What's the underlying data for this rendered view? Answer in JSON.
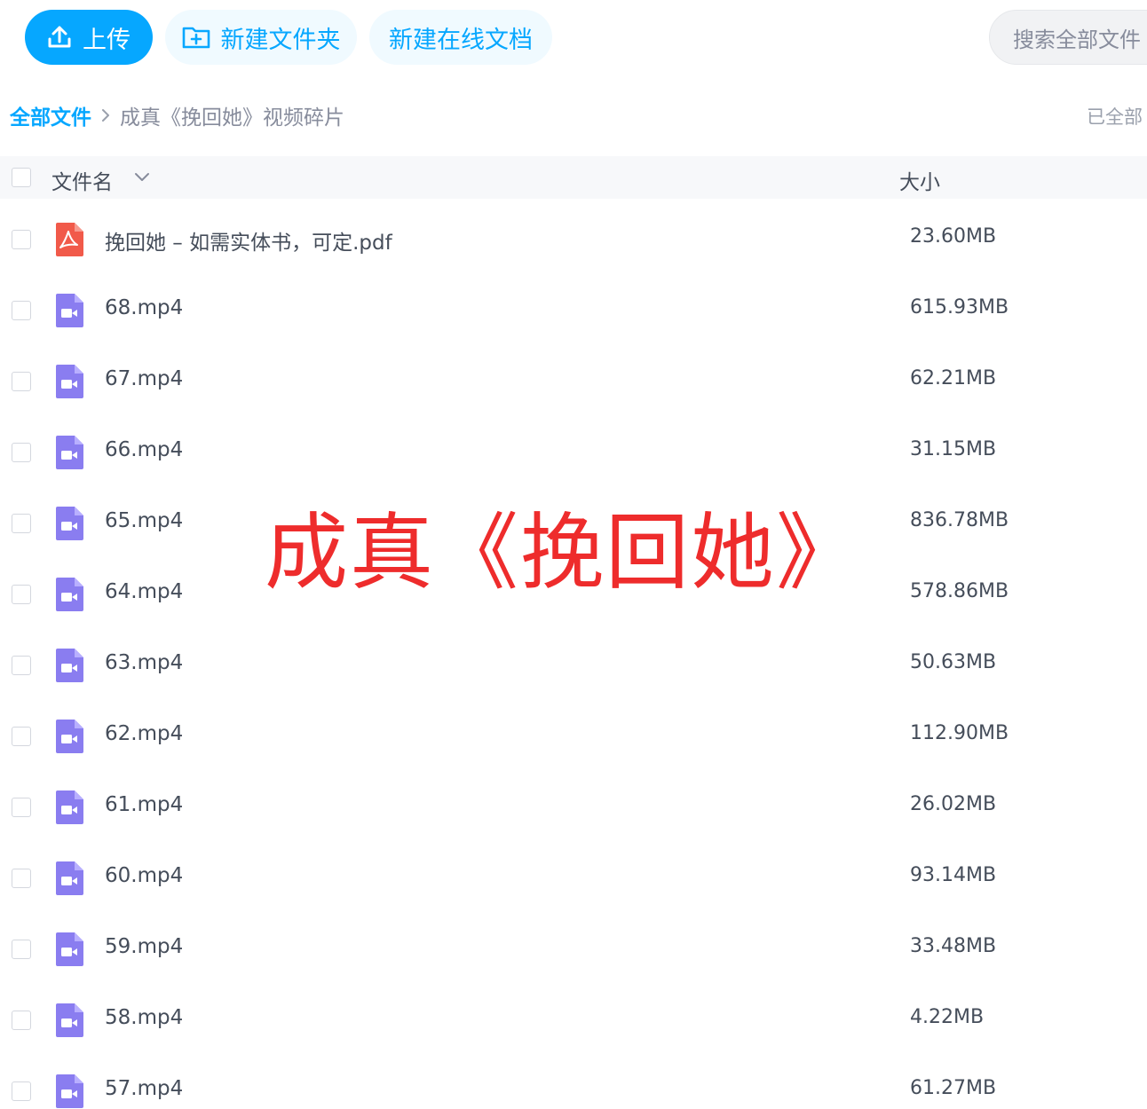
{
  "toolbar": {
    "upload_label": "上传",
    "new_folder_label": "新建文件夹",
    "new_online_doc_label": "新建在线文档",
    "search_placeholder": "搜索全部文件"
  },
  "breadcrumb": {
    "root": "全部文件",
    "current": "成真《挽回她》视频碎片",
    "loaded_status": "已全部"
  },
  "list_header": {
    "name": "文件名",
    "size": "大小"
  },
  "files": [
    {
      "name": "挽回她 – 如需实体书，可定.pdf",
      "size": "23.60MB",
      "type": "pdf"
    },
    {
      "name": "68.mp4",
      "size": "615.93MB",
      "type": "video"
    },
    {
      "name": "67.mp4",
      "size": "62.21MB",
      "type": "video"
    },
    {
      "name": "66.mp4",
      "size": "31.15MB",
      "type": "video"
    },
    {
      "name": "65.mp4",
      "size": "836.78MB",
      "type": "video"
    },
    {
      "name": "64.mp4",
      "size": "578.86MB",
      "type": "video"
    },
    {
      "name": "63.mp4",
      "size": "50.63MB",
      "type": "video"
    },
    {
      "name": "62.mp4",
      "size": "112.90MB",
      "type": "video"
    },
    {
      "name": "61.mp4",
      "size": "26.02MB",
      "type": "video"
    },
    {
      "name": "60.mp4",
      "size": "93.14MB",
      "type": "video"
    },
    {
      "name": "59.mp4",
      "size": "33.48MB",
      "type": "video"
    },
    {
      "name": "58.mp4",
      "size": "4.22MB",
      "type": "video"
    },
    {
      "name": "57.mp4",
      "size": "61.27MB",
      "type": "video"
    }
  ],
  "overlay": {
    "title": "成真《挽回她》"
  },
  "colors": {
    "accent": "#06a7ff",
    "pdf_icon": "#f15a4a",
    "video_icon": "#8a7df0",
    "overlay_text": "#ee2c2c"
  },
  "icons": {
    "upload": "upload-icon",
    "new_folder": "folder-plus-icon",
    "breadcrumb_separator": "chevron-right-icon",
    "sort": "chevron-down-icon",
    "pdf": "pdf-file-icon",
    "video": "video-file-icon"
  }
}
